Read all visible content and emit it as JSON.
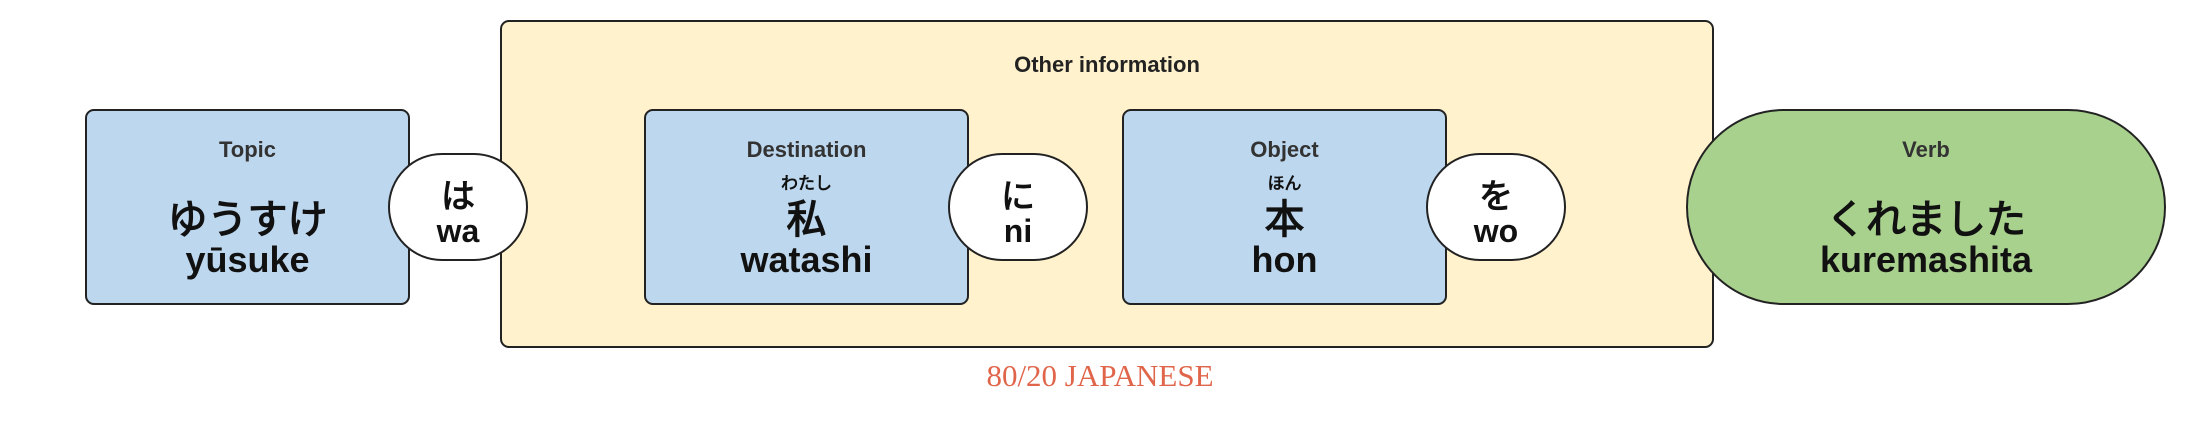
{
  "colors": {
    "word_box": "#bdd7ee",
    "verb_box": "#a9d18e",
    "group_box": "#fff2cc",
    "particle_box": "#ffffff",
    "logo": "#e0654a"
  },
  "group": {
    "title": "Other information"
  },
  "topic": {
    "category": "Topic",
    "kana": "ゆうすけ",
    "romaji": "yūsuke"
  },
  "particle_topic": {
    "kana": "は",
    "romaji": "wa"
  },
  "destination": {
    "category": "Destination",
    "furigana": "わたし",
    "kanji": "私",
    "romaji": "watashi"
  },
  "particle_destination": {
    "kana": "に",
    "romaji": "ni"
  },
  "object": {
    "category": "Object",
    "furigana": "ほん",
    "kanji": "本",
    "romaji": "hon"
  },
  "particle_object": {
    "kana": "を",
    "romaji": "wo"
  },
  "verb": {
    "category": "Verb",
    "kana": "くれました",
    "romaji": "kuremashita"
  },
  "logo": {
    "text": "80/20 JAPANESE"
  }
}
